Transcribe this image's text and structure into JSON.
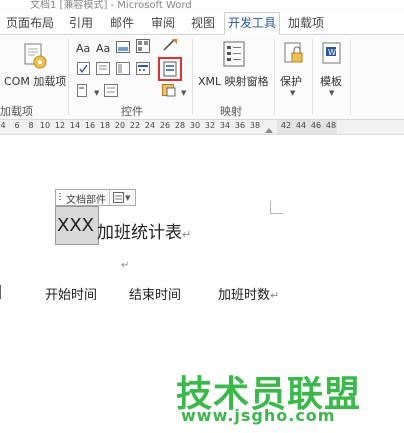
{
  "window": {
    "title": "文档1 [兼容模式] - Microsoft Word"
  },
  "tabs": [
    {
      "label": "页面布局"
    },
    {
      "label": "引用"
    },
    {
      "label": "邮件"
    },
    {
      "label": "审阅"
    },
    {
      "label": "视图"
    },
    {
      "label": "开发工具",
      "active": true
    },
    {
      "label": "加载项"
    }
  ],
  "ribbon": {
    "addins_group": {
      "label": "加载项",
      "com_button": "COM 加载项"
    },
    "controls_group": {
      "label": "控件",
      "aa1": "Aa",
      "aa2": "Aa"
    },
    "mapping_group": {
      "label": "映射",
      "xml_button": "XML 映射窗格"
    },
    "protect": {
      "label": "保护"
    },
    "templates": {
      "label": "模板"
    }
  },
  "ruler": {
    "ticks": [
      "4",
      "6",
      "8",
      "10",
      "12",
      "14",
      "16",
      "18",
      "20",
      "22",
      "24",
      "26",
      "28",
      "30",
      "32",
      "34",
      "36",
      "38",
      "42",
      "44",
      "46",
      "48"
    ]
  },
  "document": {
    "content_control_tag": "文档部件",
    "content_control_value": "XXX",
    "title_rest": "加班统计表",
    "paragraph_mark": "↵",
    "columns": [
      "开始时间",
      "结束时间",
      "加班时数"
    ]
  },
  "watermark": {
    "text": "技术员联盟",
    "url": "www.jsgho.com"
  },
  "colors": {
    "accent_blue": "#2b579a",
    "highlight_red": "#e03030",
    "watermark_green": "#3bb84a"
  }
}
